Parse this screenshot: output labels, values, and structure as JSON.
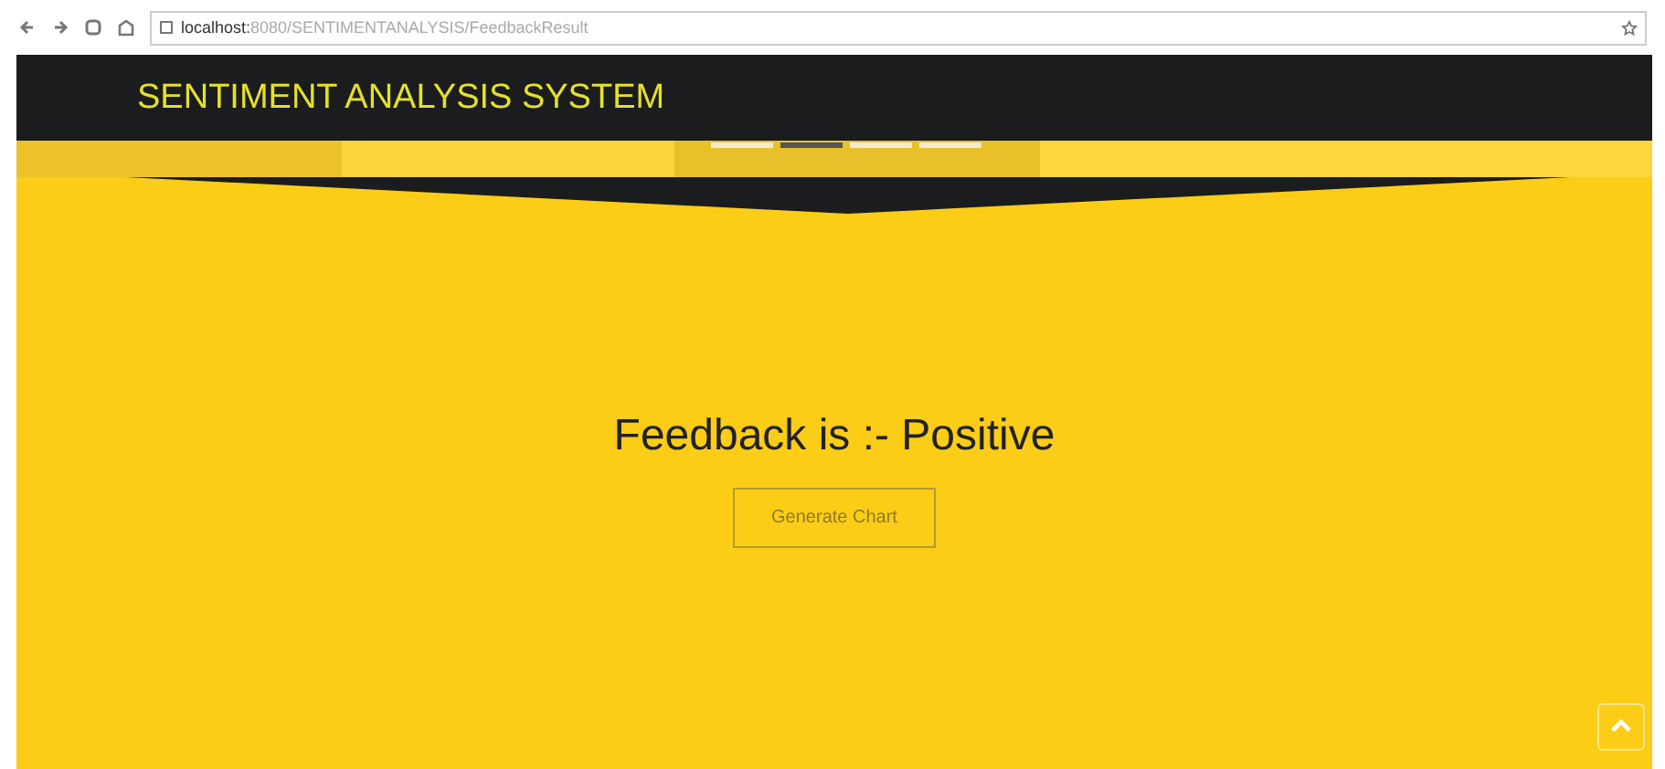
{
  "browser": {
    "url_host": "localhost:",
    "url_path": "8080/SENTIMENTANALYSIS/FeedbackResult"
  },
  "header": {
    "title": "SENTIMENT ANALYSIS SYSTEM"
  },
  "slider_indicators": [
    {
      "selected": false
    },
    {
      "selected": true
    },
    {
      "selected": false
    },
    {
      "selected": false
    }
  ],
  "result": {
    "message": "Feedback is :- Positive",
    "button": "Generate Chart"
  }
}
